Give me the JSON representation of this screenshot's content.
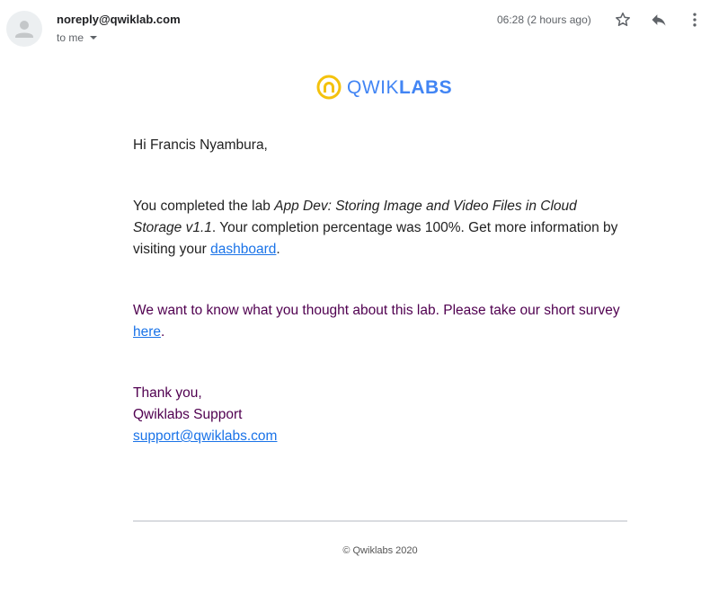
{
  "header": {
    "sender": "noreply@qwiklab.com",
    "recipient": "to me",
    "timestamp": "06:28 (2 hours ago)",
    "icons": [
      "star-icon",
      "reply-icon",
      "more-vert-icon"
    ]
  },
  "logo": {
    "part1": "QWIK",
    "part2": "LABS"
  },
  "body": {
    "greeting": "Hi Francis Nyambura,",
    "completion_prefix": "You completed the lab ",
    "lab_name": "App Dev: Storing Image and Video Files in Cloud Storage v1.1",
    "completion_suffix": ". Your completion percentage was 100%. Get more information by visiting your ",
    "dashboard_link": "dashboard",
    "period1": ".",
    "survey_text": "We want to know what you thought about this lab. Please take our short survey ",
    "survey_link": "here",
    "period2": ".",
    "thanks": "Thank you,",
    "team": "Qwiklabs Support",
    "support_email": "support@qwiklabs.com"
  },
  "footer": {
    "copyright": "© Qwiklabs 2020"
  },
  "colors": {
    "link": "#1a73e8",
    "logo_blue": "#4285f4",
    "logo_yellow": "#f4c20d",
    "survey_purple": "#500050"
  }
}
